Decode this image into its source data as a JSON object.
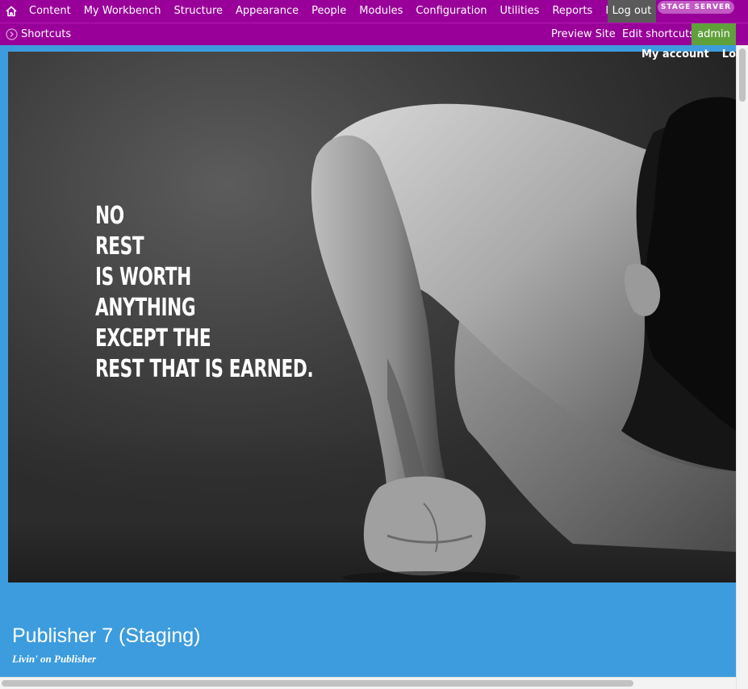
{
  "toolbar": {
    "home_icon": "home-icon",
    "menu": [
      {
        "label": "Content"
      },
      {
        "label": "My Workbench"
      },
      {
        "label": "Structure"
      },
      {
        "label": "Appearance"
      },
      {
        "label": "People"
      },
      {
        "label": "Modules"
      },
      {
        "label": "Configuration"
      },
      {
        "label": "Utilities"
      },
      {
        "label": "Reports"
      },
      {
        "label": "Help"
      }
    ],
    "logout_label": "Log out",
    "server_badge": "STAGE SERVER",
    "shortcuts_label": "Shortcuts",
    "preview_site_label": "Preview Site",
    "edit_shortcuts_label": "Edit shortcuts",
    "user_label": "admin",
    "colors": {
      "toolbar_bg": "#990099",
      "admin_bg": "#5fa03b",
      "logout_bg": "#5a5a5a"
    }
  },
  "secondary_menu": {
    "my_account": "My account",
    "logout_partial": "Lo"
  },
  "hero": {
    "quote_lines": [
      "NO",
      "REST",
      "IS WORTH",
      "ANYTHING",
      "EXCEPT THE",
      "REST THAT IS EARNED."
    ]
  },
  "site": {
    "name": "Publisher 7 (Staging)",
    "slogan": "Livin' on Publisher",
    "header_bg": "#3d9cdd"
  }
}
